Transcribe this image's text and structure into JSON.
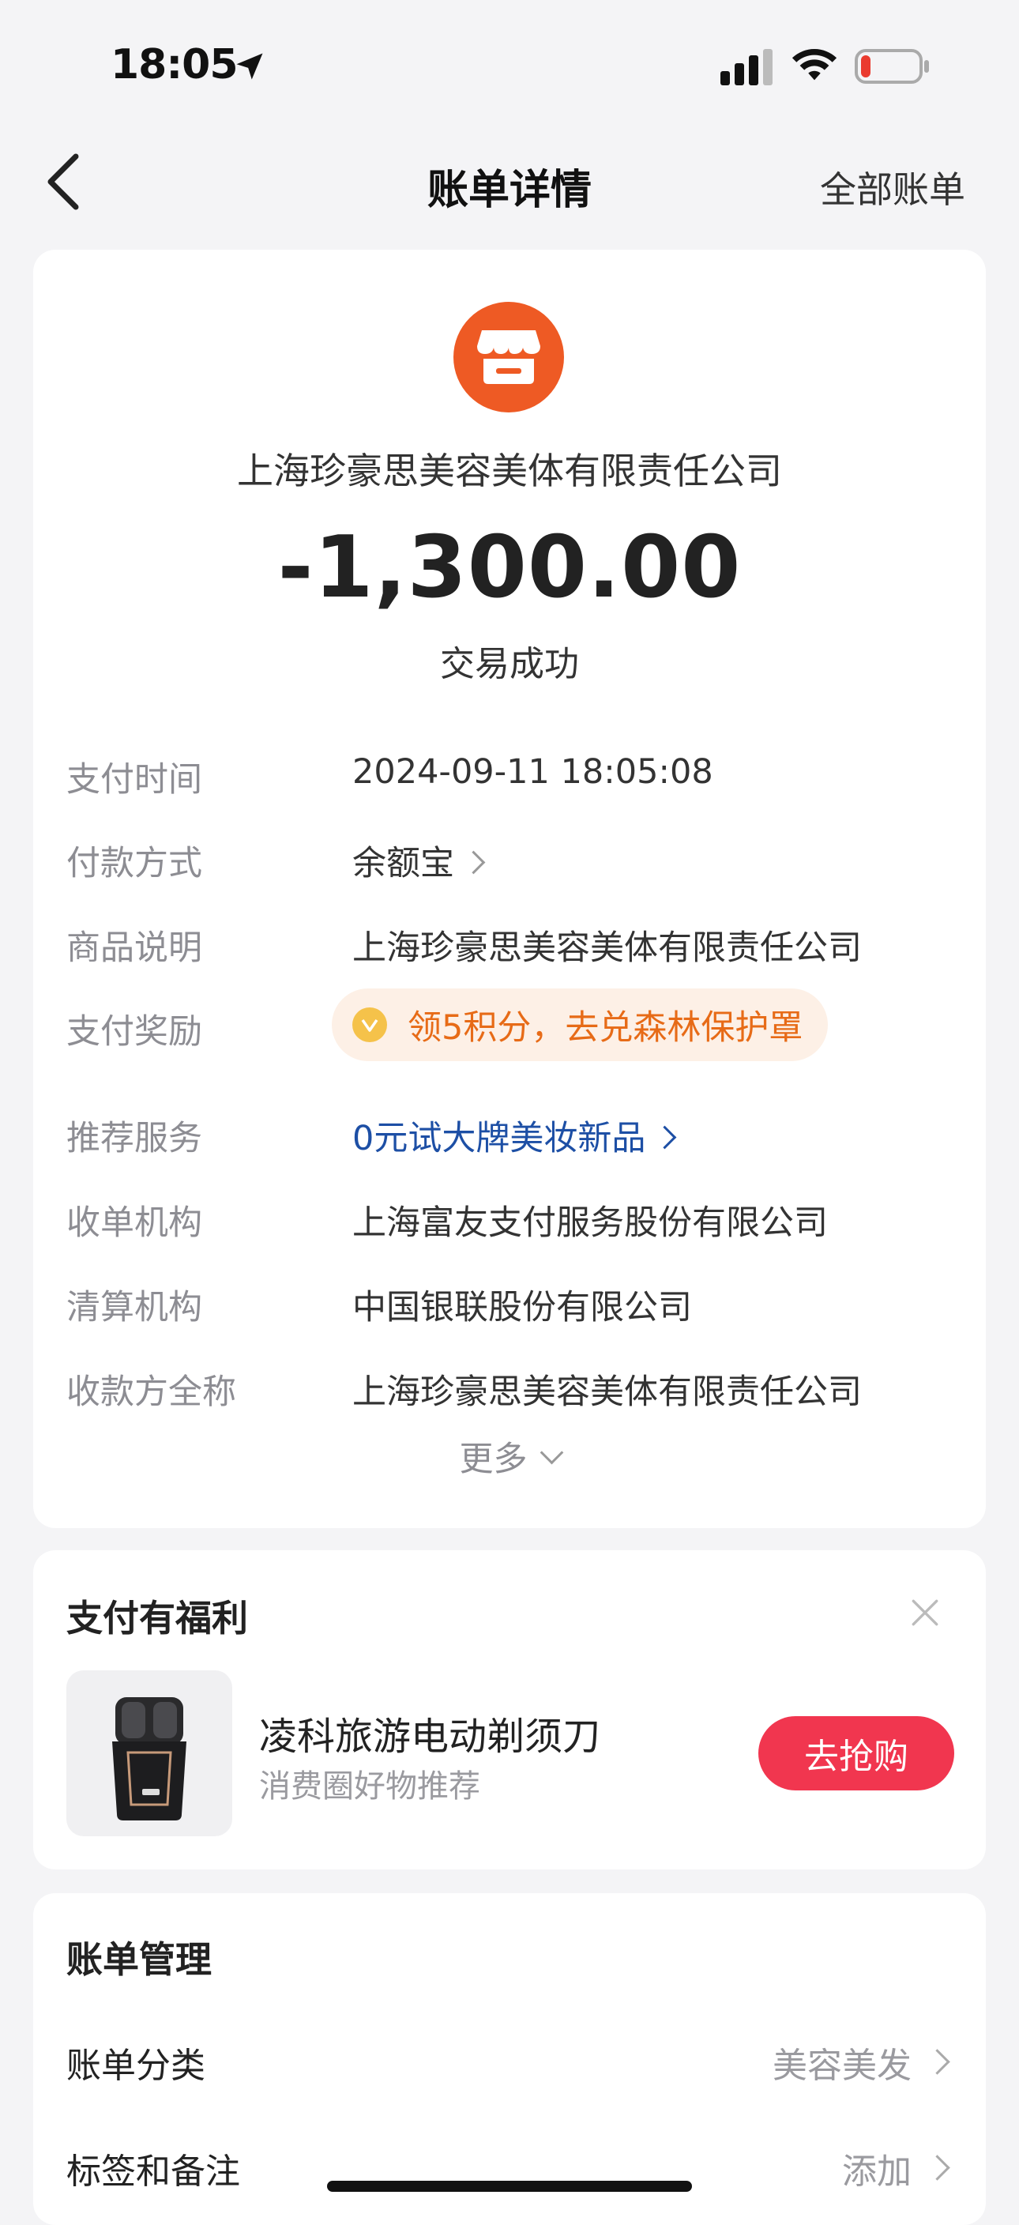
{
  "status_bar": {
    "time": "18:05"
  },
  "nav": {
    "title": "账单详情",
    "right_link": "全部账单"
  },
  "bill": {
    "merchant": "上海珍豪思美容美体有限责任公司",
    "amount": "-1,300.00",
    "status": "交易成功",
    "details": [
      {
        "label": "支付时间",
        "value": "2024-09-11 18:05:08"
      },
      {
        "label": "付款方式",
        "value": "余额宝"
      },
      {
        "label": "商品说明",
        "value": "上海珍豪思美容美体有限责任公司"
      },
      {
        "label": "支付奖励",
        "value": "领5积分，去兑森林保护罩"
      },
      {
        "label": "推荐服务",
        "value": "0元试大牌美妆新品"
      },
      {
        "label": "收单机构",
        "value": "上海富友支付服务股份有限公司"
      },
      {
        "label": "清算机构",
        "value": "中国银联股份有限公司"
      },
      {
        "label": "收款方全称",
        "value": "上海珍豪思美容美体有限责任公司"
      }
    ],
    "more_label": "更多"
  },
  "benefit": {
    "title": "支付有福利",
    "product_name": "凌科旅游电动剃须刀",
    "product_sub": "消费圈好物推荐",
    "button": "去抢购"
  },
  "manage": {
    "title": "账单管理",
    "rows": [
      {
        "label": "账单分类",
        "value": "美容美发"
      },
      {
        "label": "标签和备注",
        "value": "添加"
      }
    ]
  },
  "colors": {
    "accent_orange": "#ee5a24",
    "buy_red": "#f1364f",
    "link_blue": "#1d4fa5",
    "reward_orange": "#e76b17"
  }
}
